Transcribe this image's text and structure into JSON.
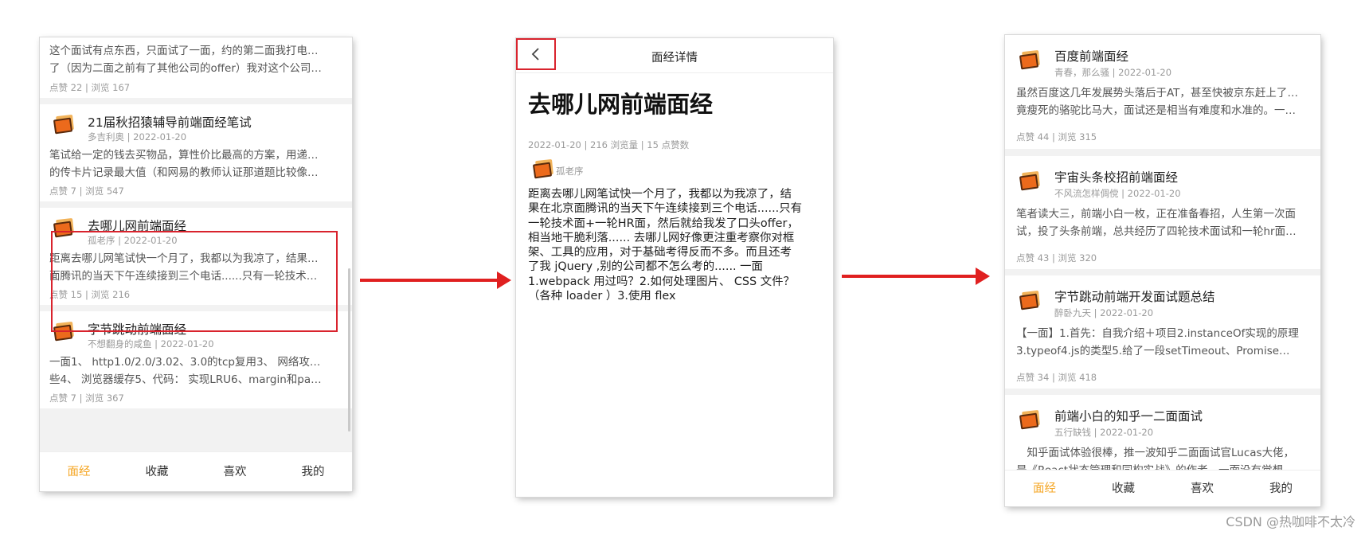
{
  "colors": {
    "accent": "#f5a623",
    "highlight": "#d9232d",
    "arrow": "#e02020"
  },
  "screen1": {
    "partial_card": {
      "body": [
        "这个面试有点东西，只面试了一面，约的第二面我打电话取消",
        "了（因为二面之前有了其他公司的offer）我对这个公司做过..."
      ],
      "stats": "点赞 22 | 浏览 167"
    },
    "cards": [
      {
        "title": "21届秋招猿辅导前端面经笔试",
        "meta": "多吉利奥 | 2022-01-20",
        "body": [
          "笔试给一定的钱去买物品，算性价比最高的方案，用递归来写",
          "的传卡片记录最大值（和网易的教师认证那道题比较像） 解..."
        ],
        "stats": "点赞 7 | 浏览 547"
      },
      {
        "title": "去哪儿网前端面经",
        "meta": "孤老序 | 2022-01-20",
        "body": [
          "距离去哪儿网笔试快一个月了，我都以为我凉了，结果在北京",
          "面腾讯的当天下午连续接到三个电话......只有一轮技术面+一..."
        ],
        "stats": "点赞 15 | 浏览 216"
      },
      {
        "title": "字节跳动前端面经",
        "meta": "不想翻身的咸鱼 | 2022-01-20",
        "body": [
          "一面1、 http1.0/2.0/3.02、3.0的tcp复用3、 网络攻击知道哪",
          "些4、 浏览器缓存5、代码： 实现LRU6、margin和paddin..."
        ],
        "stats": "点赞 7 | 浏览 367"
      }
    ],
    "tabs": [
      "面经",
      "收藏",
      "喜欢",
      "我的"
    ]
  },
  "screen2": {
    "header_title": "面经详情",
    "back_icon": "chevron-left-icon",
    "title": "去哪儿网前端面经",
    "meta": "2022-01-20 | 216 浏览量 | 15 点赞数",
    "author": "孤老序",
    "content": [
      "距离去哪儿网笔试快一个月了，我都以为我凉了，结",
      "果在北京面腾讯的当天下午连续接到三个电话......只有",
      "一轮技术面+一轮HR面，然后就给我发了口头offer，",
      "相当地干脆利落...... 去哪儿网好像更注重考察你对框",
      "架、工具的应用，对于基础考得反而不多。而且还考",
      "了我 jQuery ,别的公司都不怎么考的...... 一面",
      "1.webpack 用过吗？2.如何处理图片、 CSS 文件？",
      "（各种 loader ）3.使用 flex"
    ]
  },
  "screen3": {
    "cards": [
      {
        "title": "百度前端面经",
        "meta": "青春，那么骚 | 2022-01-20",
        "body": [
          "虽然百度这几年发展势头落后于AT，甚至快被京东赶上了，毕",
          "竟瘦死的骆驼比马大，面试还是相当有难度和水准的。一面..."
        ],
        "stats": "点赞 44 | 浏览 315"
      },
      {
        "title": "宇宙头条校招前端面经",
        "meta": "不风流怎样倜傥 | 2022-01-20",
        "body": [
          "笔者读大三，前端小白一枚，正在准备春招，人生第一次面",
          "试，投了头条前端，总共经历了四轮技术面试和一轮hr面，..."
        ],
        "stats": "点赞 43 | 浏览 320"
      },
      {
        "title": "字节跳动前端开发面试题总结",
        "meta": "醉卧九天 | 2022-01-20",
        "body": [
          "【一面】1.首先：自我介绍＋项目2.instanceOf实现的原理",
          "3.typeof4.js的类型5.给了一段setTimeout、Promise判断输..."
        ],
        "stats": "点赞 34 | 浏览 418"
      },
      {
        "title": "前端小白的知乎一二面面试",
        "meta": "五行缺钱 | 2022-01-20",
        "body": [
          "　知乎面试体验很棒，推一波知乎二面面试官Lucas大佬，",
          "是《React状态管理和同构实战》的作者，一面没有觉想的..."
        ],
        "stats": ""
      }
    ],
    "tabs": [
      "面经",
      "收藏",
      "喜欢",
      "我的"
    ]
  },
  "watermark": "CSDN @热咖啡不太冷"
}
